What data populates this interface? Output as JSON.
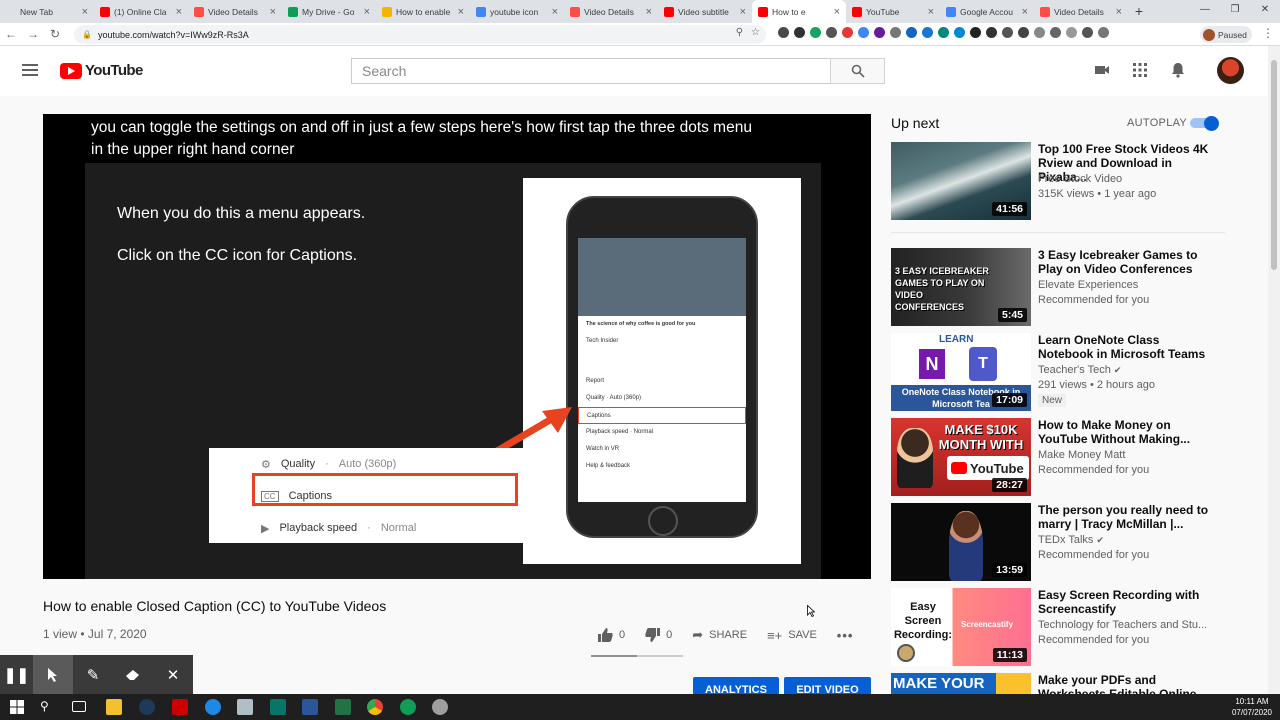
{
  "browser": {
    "tabs": [
      {
        "label": "New Tab",
        "color": "#dee1e6"
      },
      {
        "label": "(1) Online Cla",
        "color": "#ff0000"
      },
      {
        "label": "Video Details",
        "color": "#ff4e45"
      },
      {
        "label": "My Drive - Go",
        "color": "#0f9d58"
      },
      {
        "label": "How to enable",
        "color": "#f4b400"
      },
      {
        "label": "youtube icon",
        "color": "#4285f4"
      },
      {
        "label": "Video Details",
        "color": "#ff4e45"
      },
      {
        "label": "Video subtitle",
        "color": "#ff0000"
      },
      {
        "label": "How to e",
        "color": "#ff0000"
      },
      {
        "label": "YouTube",
        "color": "#ff0000"
      },
      {
        "label": "Google Accou",
        "color": "#4285f4"
      },
      {
        "label": "Video Details",
        "color": "#ff4e45"
      }
    ],
    "active_tab_index": 8,
    "url": "youtube.com/watch?v=IWw9zR-Rs3A",
    "profile_status": "Paused"
  },
  "youtube": {
    "logo_text": "YouTube",
    "search_placeholder": "Search",
    "video": {
      "caption_line1": "you can toggle the settings on and off in just a few steps here's how first tap the three dots menu",
      "caption_line2": "in the upper right hand corner",
      "slide_text1": "When you do this a menu appears.",
      "slide_text2": "Click on the CC icon for Captions.",
      "zoom_rows": [
        {
          "label": "Quality",
          "value": "Auto (360p)"
        },
        {
          "label": "Captions",
          "value": ""
        },
        {
          "label": "Playback speed",
          "value": "Normal"
        }
      ],
      "phone_menu": [
        "Report",
        "Quality · Auto (360p)",
        "Captions",
        "Playback speed · Normal",
        "Watch in VR",
        "Help & feedback"
      ],
      "phone_video_title": "The science of why coffee is good for you",
      "phone_channel": "Tech Insider"
    },
    "title": "How to enable Closed Caption (CC) to YouTube Videos",
    "views": "1 view",
    "date": "Jul 7, 2020",
    "likes": "0",
    "dislikes": "0",
    "share_label": "SHARE",
    "save_label": "SAVE",
    "analytics_label": "ANALYTICS",
    "edit_label": "EDIT VIDEO",
    "sentiment_like_fraction": 0.5
  },
  "sidebar": {
    "up_next": "Up next",
    "autoplay": "AUTOPLAY",
    "autoplay_on": true,
    "items": [
      {
        "title": "Top 100 Free Stock Videos 4K Rview and Download in Pixaba...",
        "channel": "Free Stock Video",
        "meta": "315K views • 1 year ago",
        "duration": "41:56"
      },
      {
        "title": "3 Easy Icebreaker Games to Play on Video Conferences",
        "channel": "Elevate Experiences",
        "meta": "Recommended for you",
        "duration": "5:45",
        "thumb_text": "3 EASY ICEBREAKER GAMES TO PLAY ON VIDEO CONFERENCES"
      },
      {
        "title": "Learn OneNote Class Notebook in Microsoft Teams",
        "channel": "Teacher's Tech",
        "meta": "291 views • 2 hours ago",
        "duration": "17:09",
        "badge": "New",
        "thumb_text_top": "LEARN",
        "thumb_text_bottom": "OneNote Class Notebook in Microsoft Tea"
      },
      {
        "title": "How to Make Money on YouTube Without Making...",
        "channel": "Make Money Matt",
        "meta": "Recommended for you",
        "duration": "28:27",
        "thumb_text": "MAKE $10K MONTH WITH",
        "thumb_text2": "YouTube"
      },
      {
        "title": "The person you really need to marry | Tracy McMillan |...",
        "channel": "TEDx Talks",
        "meta": "Recommended for you",
        "duration": "13:59"
      },
      {
        "title": "Easy Screen Recording with Screencastify",
        "channel": "Technology for Teachers and Stu...",
        "meta": "Recommended for you",
        "duration": "11:13",
        "thumb_text": "Easy Screen Recording:",
        "thumb_text2": "Screencastify"
      },
      {
        "title": "Make your PDFs and Worksheets Editable Online",
        "channel": "",
        "meta": "",
        "duration": "",
        "thumb_text": "MAKE YOUR"
      }
    ]
  },
  "taskbar": {
    "time": "10:11 AM",
    "date": "07/07/2020"
  }
}
